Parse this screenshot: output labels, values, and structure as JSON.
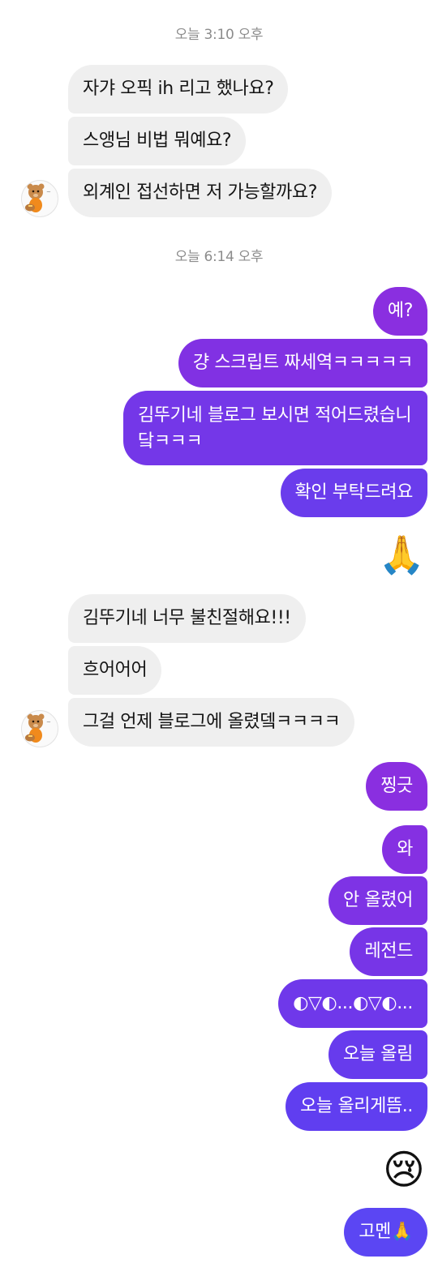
{
  "timestamps": {
    "first": "오늘 3:10 오후",
    "second": "오늘 6:14 오후"
  },
  "incoming_group_1": [
    "자갸 오픽 ih 리고 했나요?",
    "스앵님 비법 뭐예요?",
    "외계인 접선하면 저 가능할까요?"
  ],
  "outgoing_group_1": [
    "예?",
    "걍 스크립트 짜세역ㅋㅋㅋㅋㅋ",
    "김뚜기네 블로그 보시면 적어드렸습니닼ㅋㅋㅋ",
    "확인 부탁드려요"
  ],
  "outgoing_emoji_1": "🙏",
  "incoming_group_2": [
    "김뚜기네 너무 불친절해요!!!",
    "흐어어어",
    "그걸 언제 블로그에 올렸뎈ㅋㅋㅋㅋ"
  ],
  "outgoing_group_2": [
    "찡긋",
    "와",
    "안 올렸어",
    "레전드",
    "◐▽◐...◐▽◐...",
    "오늘 올림",
    "오늘 올리게뜸.."
  ],
  "outgoing_emoji_2": "😢",
  "outgoing_last": "고멘🙏",
  "colors": {
    "incoming_bubble": "#efefef",
    "outgoing_top": "#8a2be2",
    "outgoing_bottom": "#5b4cf5"
  },
  "icons": {
    "avatar": "bear-character-avatar"
  }
}
